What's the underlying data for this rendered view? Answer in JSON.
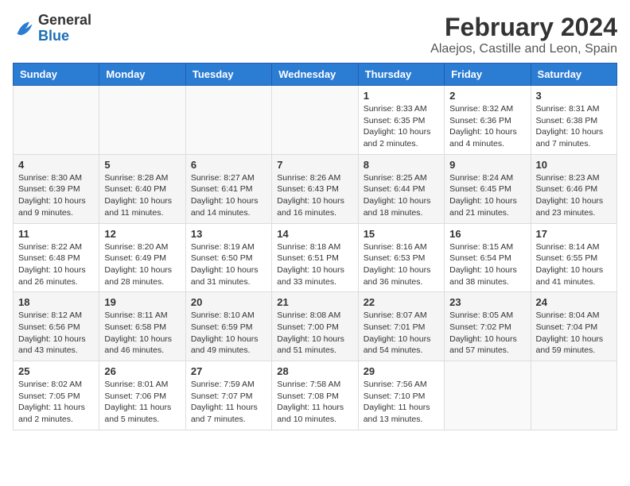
{
  "logo": {
    "general": "General",
    "blue": "Blue"
  },
  "title": "February 2024",
  "subtitle": "Alaejos, Castille and Leon, Spain",
  "days_of_week": [
    "Sunday",
    "Monday",
    "Tuesday",
    "Wednesday",
    "Thursday",
    "Friday",
    "Saturday"
  ],
  "weeks": [
    [
      {
        "day": "",
        "info": ""
      },
      {
        "day": "",
        "info": ""
      },
      {
        "day": "",
        "info": ""
      },
      {
        "day": "",
        "info": ""
      },
      {
        "day": "1",
        "info": "Sunrise: 8:33 AM\nSunset: 6:35 PM\nDaylight: 10 hours\nand 2 minutes."
      },
      {
        "day": "2",
        "info": "Sunrise: 8:32 AM\nSunset: 6:36 PM\nDaylight: 10 hours\nand 4 minutes."
      },
      {
        "day": "3",
        "info": "Sunrise: 8:31 AM\nSunset: 6:38 PM\nDaylight: 10 hours\nand 7 minutes."
      }
    ],
    [
      {
        "day": "4",
        "info": "Sunrise: 8:30 AM\nSunset: 6:39 PM\nDaylight: 10 hours\nand 9 minutes."
      },
      {
        "day": "5",
        "info": "Sunrise: 8:28 AM\nSunset: 6:40 PM\nDaylight: 10 hours\nand 11 minutes."
      },
      {
        "day": "6",
        "info": "Sunrise: 8:27 AM\nSunset: 6:41 PM\nDaylight: 10 hours\nand 14 minutes."
      },
      {
        "day": "7",
        "info": "Sunrise: 8:26 AM\nSunset: 6:43 PM\nDaylight: 10 hours\nand 16 minutes."
      },
      {
        "day": "8",
        "info": "Sunrise: 8:25 AM\nSunset: 6:44 PM\nDaylight: 10 hours\nand 18 minutes."
      },
      {
        "day": "9",
        "info": "Sunrise: 8:24 AM\nSunset: 6:45 PM\nDaylight: 10 hours\nand 21 minutes."
      },
      {
        "day": "10",
        "info": "Sunrise: 8:23 AM\nSunset: 6:46 PM\nDaylight: 10 hours\nand 23 minutes."
      }
    ],
    [
      {
        "day": "11",
        "info": "Sunrise: 8:22 AM\nSunset: 6:48 PM\nDaylight: 10 hours\nand 26 minutes."
      },
      {
        "day": "12",
        "info": "Sunrise: 8:20 AM\nSunset: 6:49 PM\nDaylight: 10 hours\nand 28 minutes."
      },
      {
        "day": "13",
        "info": "Sunrise: 8:19 AM\nSunset: 6:50 PM\nDaylight: 10 hours\nand 31 minutes."
      },
      {
        "day": "14",
        "info": "Sunrise: 8:18 AM\nSunset: 6:51 PM\nDaylight: 10 hours\nand 33 minutes."
      },
      {
        "day": "15",
        "info": "Sunrise: 8:16 AM\nSunset: 6:53 PM\nDaylight: 10 hours\nand 36 minutes."
      },
      {
        "day": "16",
        "info": "Sunrise: 8:15 AM\nSunset: 6:54 PM\nDaylight: 10 hours\nand 38 minutes."
      },
      {
        "day": "17",
        "info": "Sunrise: 8:14 AM\nSunset: 6:55 PM\nDaylight: 10 hours\nand 41 minutes."
      }
    ],
    [
      {
        "day": "18",
        "info": "Sunrise: 8:12 AM\nSunset: 6:56 PM\nDaylight: 10 hours\nand 43 minutes."
      },
      {
        "day": "19",
        "info": "Sunrise: 8:11 AM\nSunset: 6:58 PM\nDaylight: 10 hours\nand 46 minutes."
      },
      {
        "day": "20",
        "info": "Sunrise: 8:10 AM\nSunset: 6:59 PM\nDaylight: 10 hours\nand 49 minutes."
      },
      {
        "day": "21",
        "info": "Sunrise: 8:08 AM\nSunset: 7:00 PM\nDaylight: 10 hours\nand 51 minutes."
      },
      {
        "day": "22",
        "info": "Sunrise: 8:07 AM\nSunset: 7:01 PM\nDaylight: 10 hours\nand 54 minutes."
      },
      {
        "day": "23",
        "info": "Sunrise: 8:05 AM\nSunset: 7:02 PM\nDaylight: 10 hours\nand 57 minutes."
      },
      {
        "day": "24",
        "info": "Sunrise: 8:04 AM\nSunset: 7:04 PM\nDaylight: 10 hours\nand 59 minutes."
      }
    ],
    [
      {
        "day": "25",
        "info": "Sunrise: 8:02 AM\nSunset: 7:05 PM\nDaylight: 11 hours\nand 2 minutes."
      },
      {
        "day": "26",
        "info": "Sunrise: 8:01 AM\nSunset: 7:06 PM\nDaylight: 11 hours\nand 5 minutes."
      },
      {
        "day": "27",
        "info": "Sunrise: 7:59 AM\nSunset: 7:07 PM\nDaylight: 11 hours\nand 7 minutes."
      },
      {
        "day": "28",
        "info": "Sunrise: 7:58 AM\nSunset: 7:08 PM\nDaylight: 11 hours\nand 10 minutes."
      },
      {
        "day": "29",
        "info": "Sunrise: 7:56 AM\nSunset: 7:10 PM\nDaylight: 11 hours\nand 13 minutes."
      },
      {
        "day": "",
        "info": ""
      },
      {
        "day": "",
        "info": ""
      }
    ]
  ]
}
